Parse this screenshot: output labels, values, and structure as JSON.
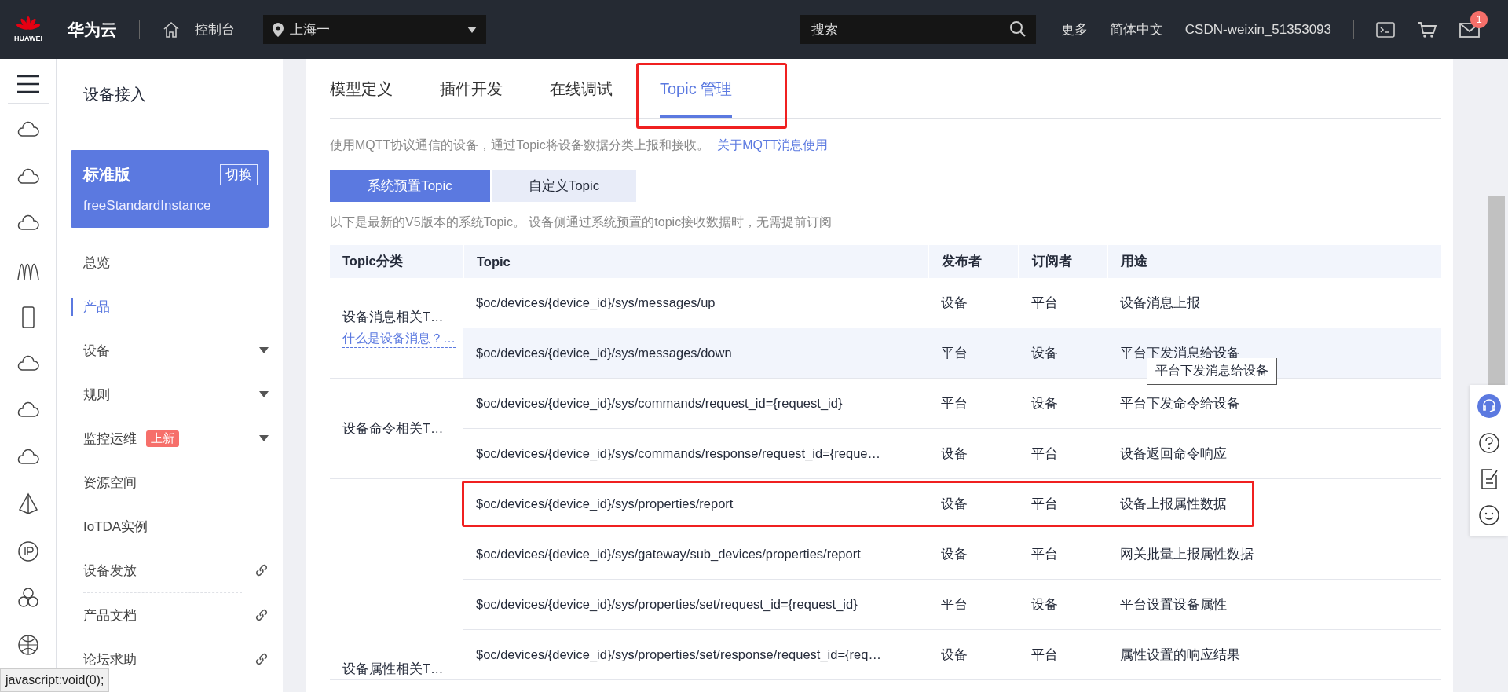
{
  "topbar": {
    "logo_text": "HUAWEI",
    "brand": "华为云",
    "console": "控制台",
    "region": "上海一",
    "search": {
      "placeholder": "搜索"
    },
    "links": [
      "更多",
      "简体中文",
      "CSDN-weixin_51353093"
    ],
    "mail_badge": "1"
  },
  "sidebar": {
    "title": "设备接入",
    "instance": {
      "edition": "标准版",
      "switch": "切换",
      "name": "freeStandardInstance"
    },
    "items": [
      {
        "label": "总览",
        "kind": "plain",
        "selected": false
      },
      {
        "label": "产品",
        "kind": "plain",
        "selected": true
      },
      {
        "label": "设备",
        "kind": "expand",
        "selected": false
      },
      {
        "label": "规则",
        "kind": "expand",
        "selected": false
      },
      {
        "label": "监控运维",
        "kind": "expand",
        "badge": "上新",
        "selected": false
      },
      {
        "label": "资源空间",
        "kind": "plain",
        "selected": false
      },
      {
        "label": "IoTDA实例",
        "kind": "plain",
        "selected": false
      },
      {
        "label": "设备发放",
        "kind": "external",
        "selected": false
      }
    ],
    "help_links": [
      {
        "label": "产品文档",
        "kind": "external",
        "selected": false
      },
      {
        "label": "论坛求助",
        "kind": "external",
        "selected": false
      }
    ]
  },
  "tabs": [
    {
      "label": "模型定义",
      "selected": false,
      "annotated": false
    },
    {
      "label": "插件开发",
      "selected": false,
      "annotated": false
    },
    {
      "label": "在线调试",
      "selected": false,
      "annotated": false
    },
    {
      "label": "Topic 管理",
      "selected": true,
      "annotated": true
    }
  ],
  "description": {
    "text": "使用MQTT协议通信的设备，通过Topic将设备数据分类上报和接收。",
    "link": "关于MQTT消息使用"
  },
  "segments": [
    {
      "label": "系统预置Topic",
      "selected": true
    },
    {
      "label": "自定义Topic",
      "selected": false
    }
  ],
  "note": "以下是最新的V5版本的系统Topic。 设备侧通过系统预置的topic接收数据时，无需提前订阅",
  "table": {
    "columns": [
      "Topic分类",
      "Topic",
      "发布者",
      "订阅者",
      "用途"
    ],
    "groups": [
      {
        "category": "设备消息相关T…",
        "help_link": "什么是设备消息？…",
        "rows": [
          {
            "topic": "$oc/devices/{device_id}/sys/messages/up",
            "publisher": "设备",
            "subscriber": "平台",
            "usage": "设备消息上报",
            "hovered": false,
            "annotated": false
          },
          {
            "topic": "$oc/devices/{device_id}/sys/messages/down",
            "publisher": "平台",
            "subscriber": "设备",
            "usage": "平台下发消息给设备",
            "hovered": true,
            "annotated": false,
            "tooltip": "平台下发消息给设备"
          }
        ]
      },
      {
        "category": "设备命令相关T…",
        "rows": [
          {
            "topic": "$oc/devices/{device_id}/sys/commands/request_id={request_id}",
            "publisher": "平台",
            "subscriber": "设备",
            "usage": "平台下发命令给设备",
            "hovered": false,
            "annotated": false
          },
          {
            "topic": "$oc/devices/{device_id}/sys/commands/response/request_id={reque…",
            "publisher": "设备",
            "subscriber": "平台",
            "usage": "设备返回命令响应",
            "hovered": false,
            "annotated": false
          }
        ]
      },
      {
        "category": "设备属性相关T…",
        "rows": [
          {
            "topic": "$oc/devices/{device_id}/sys/properties/report",
            "publisher": "设备",
            "subscriber": "平台",
            "usage": "设备上报属性数据",
            "hovered": false,
            "annotated": true
          },
          {
            "topic": "$oc/devices/{device_id}/sys/gateway/sub_devices/properties/report",
            "publisher": "设备",
            "subscriber": "平台",
            "usage": "网关批量上报属性数据",
            "hovered": false,
            "annotated": false
          },
          {
            "topic": "$oc/devices/{device_id}/sys/properties/set/request_id={request_id}",
            "publisher": "平台",
            "subscriber": "设备",
            "usage": "平台设置设备属性",
            "hovered": false,
            "annotated": false
          },
          {
            "topic": "$oc/devices/{device_id}/sys/properties/set/response/request_id={req…",
            "publisher": "设备",
            "subscriber": "平台",
            "usage": "属性设置的响应结果",
            "hovered": false,
            "annotated": false
          }
        ]
      }
    ]
  },
  "status_bar": "javascript:void(0);"
}
